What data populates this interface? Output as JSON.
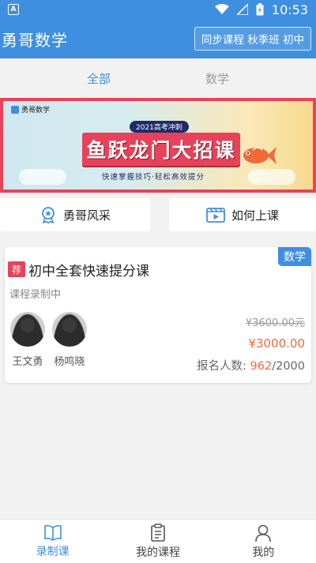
{
  "status_bar": {
    "time": "10:53",
    "app_indicator": "A"
  },
  "header": {
    "title": "勇哥数学",
    "course_selector": "同步课程 秋季班 初中"
  },
  "tabs": [
    {
      "label": "全部",
      "active": true
    },
    {
      "label": "数学",
      "active": false
    }
  ],
  "banner": {
    "logo_text": "勇哥数学",
    "subtitle": "2021高考冲刺",
    "main_text": "鱼跃龙门大招课",
    "tagline": "快速掌握技巧·轻松高效提分"
  },
  "quick_actions": [
    {
      "label": "勇哥风采",
      "icon": "medal-icon"
    },
    {
      "label": "如何上课",
      "icon": "video-icon"
    }
  ],
  "course": {
    "subject": "数学",
    "recommend_tag": "荐",
    "title": "初中全套快速提分课",
    "status": "课程录制中",
    "teachers": [
      {
        "name": "王文勇"
      },
      {
        "name": "杨鸣晓"
      }
    ],
    "original_price": "¥3600.00元",
    "sale_price": "¥3000.00",
    "enroll_label": "报名人数:",
    "enroll_count": "962",
    "enroll_total": "/2000"
  },
  "bottom_nav": [
    {
      "label": "录制课",
      "icon": "book-icon",
      "active": true
    },
    {
      "label": "我的课程",
      "icon": "clipboard-icon",
      "active": false
    },
    {
      "label": "我的",
      "icon": "person-icon",
      "active": false
    }
  ],
  "colors": {
    "primary": "#3f8fe0",
    "accent_red": "#e8425a",
    "price_orange": "#f26a3a"
  }
}
